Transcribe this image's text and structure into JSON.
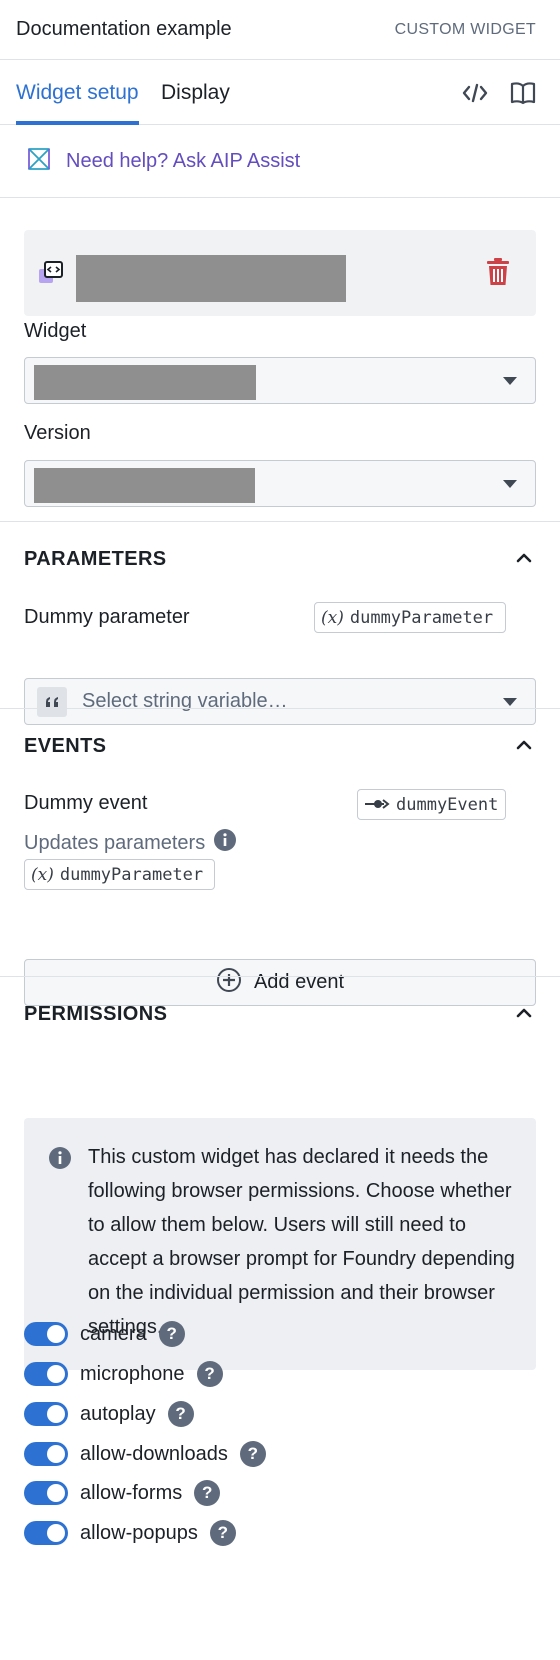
{
  "header": {
    "title": "Documentation example",
    "type_label": "CUSTOM WIDGET"
  },
  "tabs": [
    {
      "label": "Widget setup",
      "active": true
    },
    {
      "label": "Display",
      "active": false
    }
  ],
  "aip": {
    "label": "Need help? Ask AIP Assist"
  },
  "widget_field": {
    "label": "Widget"
  },
  "version_field": {
    "label": "Version"
  },
  "parameters": {
    "title": "PARAMETERS",
    "param_label": "Dummy parameter",
    "param_var": "(x)",
    "param_id": "dummyParameter",
    "select_placeholder": "Select string variable…",
    "quote_icon": "quote-icon"
  },
  "events": {
    "title": "EVENTS",
    "event_label": "Dummy event",
    "event_id": "dummyEvent",
    "updates_label": "Updates parameters",
    "updated_var": "(x)",
    "updated_param": "dummyParameter",
    "add_label": "Add event"
  },
  "permissions": {
    "title": "PERMISSIONS",
    "callout": "This custom widget has declared it needs the following browser permissions. Choose whether to allow them below. Users will still need to accept a browser prompt for Foundry depending on the individual permission and their browser settings.",
    "items": [
      {
        "label": "camera",
        "enabled": true
      },
      {
        "label": "microphone",
        "enabled": true
      },
      {
        "label": "autoplay",
        "enabled": true
      },
      {
        "label": "allow-downloads",
        "enabled": true
      },
      {
        "label": "allow-forms",
        "enabled": true
      },
      {
        "label": "allow-popups",
        "enabled": true
      }
    ],
    "help_glyph": "?"
  },
  "colors": {
    "accent": "#2d72d2",
    "danger": "#cd4246",
    "aip": "#634dbf",
    "redaction": "#8f8f8f"
  }
}
